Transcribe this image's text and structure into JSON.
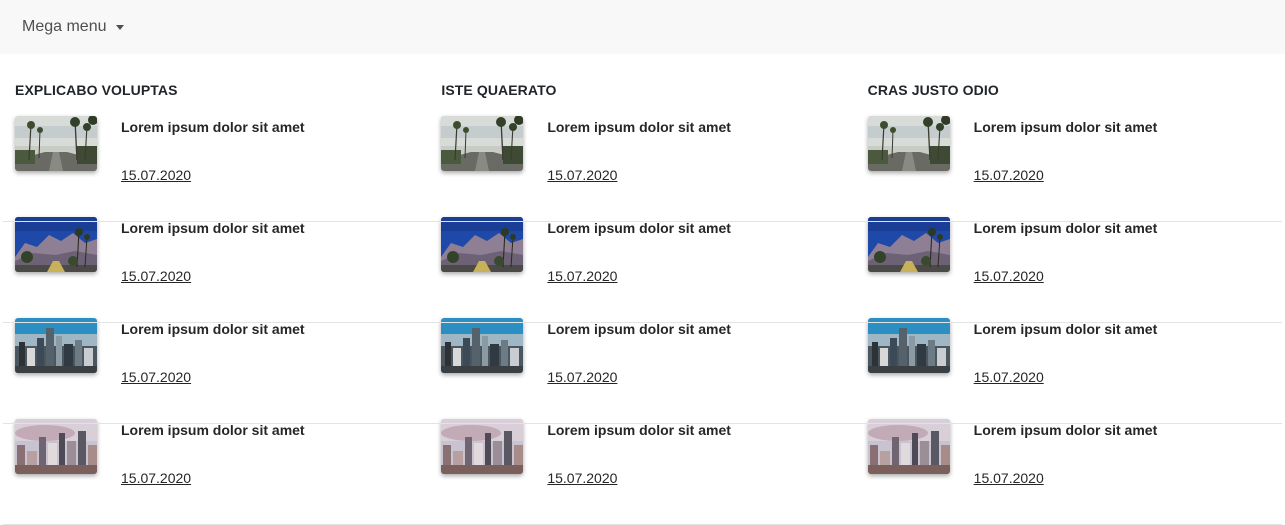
{
  "navbar": {
    "toggle_label": "Mega menu"
  },
  "columns": [
    {
      "title": "EXPLICABO VOLUPTAS",
      "items": [
        {
          "title": "Lorem ipsum dolor sit amet",
          "date": "15.07.2020",
          "image": "palm-street"
        },
        {
          "title": "Lorem ipsum dolor sit amet",
          "date": "15.07.2020",
          "image": "palm-mountain"
        },
        {
          "title": "Lorem ipsum dolor sit amet",
          "date": "15.07.2020",
          "image": "city-skyline"
        },
        {
          "title": "Lorem ipsum dolor sit amet",
          "date": "15.07.2020",
          "image": "city-dusk"
        }
      ]
    },
    {
      "title": "ISTE QUAERATO",
      "items": [
        {
          "title": "Lorem ipsum dolor sit amet",
          "date": "15.07.2020",
          "image": "palm-street"
        },
        {
          "title": "Lorem ipsum dolor sit amet",
          "date": "15.07.2020",
          "image": "palm-mountain"
        },
        {
          "title": "Lorem ipsum dolor sit amet",
          "date": "15.07.2020",
          "image": "city-skyline"
        },
        {
          "title": "Lorem ipsum dolor sit amet",
          "date": "15.07.2020",
          "image": "city-dusk"
        }
      ]
    },
    {
      "title": "CRAS JUSTO ODIO",
      "items": [
        {
          "title": "Lorem ipsum dolor sit amet",
          "date": "15.07.2020",
          "image": "palm-street"
        },
        {
          "title": "Lorem ipsum dolor sit amet",
          "date": "15.07.2020",
          "image": "palm-mountain"
        },
        {
          "title": "Lorem ipsum dolor sit amet",
          "date": "15.07.2020",
          "image": "city-skyline"
        },
        {
          "title": "Lorem ipsum dolor sit amet",
          "date": "15.07.2020",
          "image": "city-dusk"
        }
      ]
    }
  ]
}
